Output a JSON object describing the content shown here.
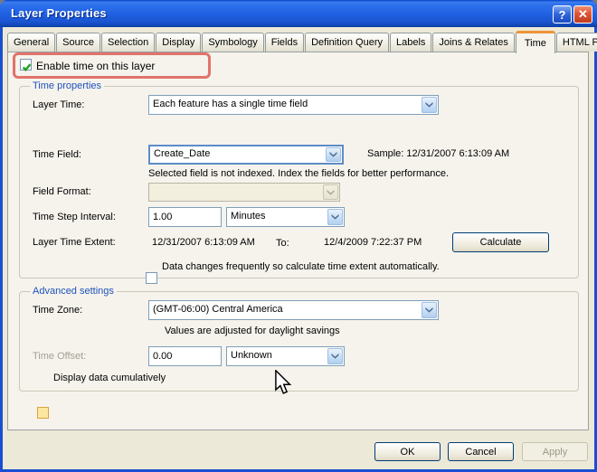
{
  "window": {
    "title": "Layer Properties",
    "help_glyph": "?",
    "close_glyph": "✕"
  },
  "tabs": [
    {
      "label": "General",
      "active": false
    },
    {
      "label": "Source",
      "active": false
    },
    {
      "label": "Selection",
      "active": false
    },
    {
      "label": "Display",
      "active": false
    },
    {
      "label": "Symbology",
      "active": false
    },
    {
      "label": "Fields",
      "active": false
    },
    {
      "label": "Definition Query",
      "active": false
    },
    {
      "label": "Labels",
      "active": false
    },
    {
      "label": "Joins & Relates",
      "active": false
    },
    {
      "label": "Time",
      "active": true
    },
    {
      "label": "HTML Popup",
      "active": false
    }
  ],
  "enable_time": {
    "label": "Enable time on this layer",
    "checked": true
  },
  "time_properties": {
    "title": "Time properties",
    "layer_time": {
      "label": "Layer Time:",
      "value": "Each feature has a single time field"
    },
    "time_field": {
      "label": "Time Field:",
      "value": "Create_Date",
      "sample": "Sample: 12/31/2007 6:13:09 AM",
      "note": "Selected field is not indexed. Index the fields for better performance."
    },
    "field_format": {
      "label": "Field Format:",
      "value": ""
    },
    "time_step": {
      "label": "Time Step Interval:",
      "value": "1.00",
      "unit": "Minutes"
    },
    "extent": {
      "label": "Layer Time Extent:",
      "start": "12/31/2007 6:13:09 AM",
      "to_label": "To:",
      "end": "12/4/2009 7:22:37 PM",
      "button": "Calculate"
    },
    "auto_calc": {
      "label": "Data changes frequently so calculate time extent automatically.",
      "checked": false
    }
  },
  "advanced": {
    "title": "Advanced settings",
    "time_zone": {
      "label": "Time Zone:",
      "value": "(GMT-06:00) Central America"
    },
    "daylight": {
      "label": "Values are adjusted for daylight savings",
      "checked": true
    },
    "time_offset": {
      "label": "Time Offset:",
      "value": "0.00",
      "unit": "Unknown"
    },
    "cumulative": {
      "label": "Display data cumulatively",
      "checked": false
    }
  },
  "footer": {
    "ok": "OK",
    "cancel": "Cancel",
    "apply": "Apply"
  },
  "colors": {
    "titlebar_blue": "#1B4FD3",
    "dialog_tan": "#ECE9D8",
    "tab_page": "#F5F3EC",
    "highlight_red": "#E0736B",
    "tab_accent_orange": "#ED9438",
    "group_label_blue": "#1F52BD",
    "check_green": "#21A121"
  }
}
